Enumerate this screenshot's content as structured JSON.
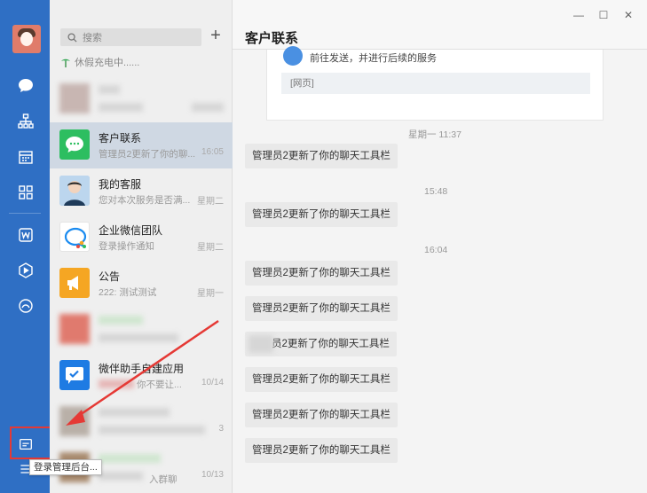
{
  "window": {
    "minimize": "—",
    "maximize": "☐",
    "close": "✕"
  },
  "search": {
    "placeholder": "搜索"
  },
  "status": {
    "text": "休假充电中......"
  },
  "sessions": [
    {
      "name": "客户联系",
      "preview": "管理员2更新了你的聊...",
      "time": "16:05",
      "icon": "chat-bubble-icon",
      "color": "#2dbe60"
    },
    {
      "name": "我的客服",
      "preview": "您对本次服务是否满...",
      "time": "星期二",
      "icon": "avatar-photo",
      "color": "#7aa7d4"
    },
    {
      "name": "企业微信团队",
      "preview": "登录操作通知",
      "time": "星期二",
      "icon": "wecom-logo-icon",
      "color": "#ffffff"
    },
    {
      "name": "公告",
      "preview": "222: 测试测试",
      "time": "星期一",
      "icon": "megaphone-icon",
      "color": "#f5a623"
    },
    {
      "name": "微伴助手自建应用",
      "preview": "你不要让...",
      "time": "10/14",
      "icon": "checkmark-chat-icon",
      "color": "#1e7be3"
    }
  ],
  "chat": {
    "title": "客户联系",
    "card_text": "前往发送，并进行后续的服务",
    "card_footer": "[网页]",
    "timestamps": [
      "星期一 11:37",
      "15:48",
      "16:04"
    ],
    "message": "管理员2更新了你的聊天工具栏",
    "message_partial": "员2更新了你的聊天工具栏"
  },
  "tooltip": {
    "text": "登录管理后台..."
  },
  "blurred_times": [
    "3",
    "10/13"
  ],
  "blurred_preview": "入群聊",
  "colors": {
    "rail": "#2f6fc4",
    "highlight": "#e53935"
  }
}
